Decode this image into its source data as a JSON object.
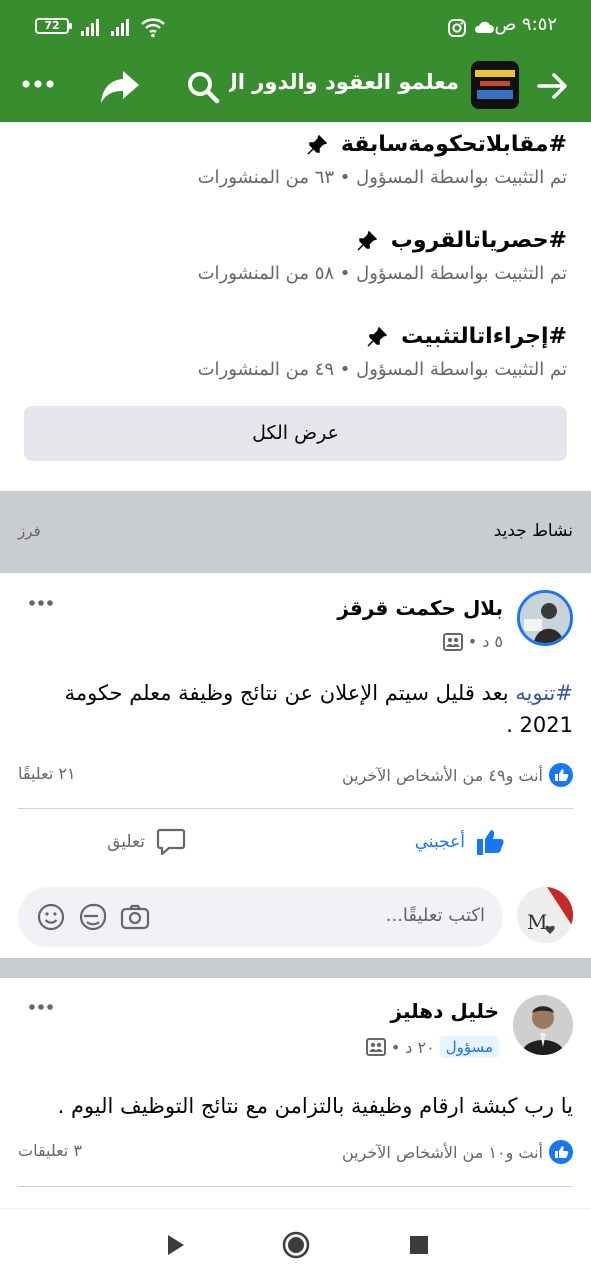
{
  "status_bar": {
    "time": "٩:٥٢ ص",
    "battery": "72"
  },
  "app_bar": {
    "title": "معلمو العقود والدور ال..",
    "back_icon": "arrow-right-icon",
    "search_icon": "search-icon",
    "share_icon": "share-icon",
    "more_icon": "more-icon"
  },
  "pinned": [
    {
      "tag": "#مقابلاتحكومةسابقة",
      "meta": "تم التثبيت بواسطة المسؤول • ٦٣ من المنشورات"
    },
    {
      "tag": "#حصرياتالقروب",
      "meta": "تم التثبيت بواسطة المسؤول • ٥٨ من المنشورات"
    },
    {
      "tag": "#إجراءاتالتثبيت",
      "meta": "تم التثبيت بواسطة المسؤول • ٤٩ من المنشورات"
    }
  ],
  "see_all_label": "عرض الكل",
  "activity": {
    "title": "نشاط جديد",
    "sort": "فرز"
  },
  "post1": {
    "author": "بلال حكمت قرقز",
    "time": "٥ د",
    "hashtag": "#تنويه",
    "text": " بعد قليل سيتم الإعلان عن نتائج وظيفة معلم حكومة 2021 .",
    "reactions": "أنت و٤٩ من الأشخاص الآخرين",
    "comments": "٢١ تعليقًا",
    "like_label": "أعجبني",
    "comment_label": "تعليق",
    "comment_placeholder": "اكتب تعليقًا..."
  },
  "post2": {
    "author": "خليل دهليز",
    "badge": "مسؤول",
    "time": "٢٠ د",
    "text": "يا رب كبشة ارقام وظيفية بالتزامن مع نتائج  التوظيف اليوم .",
    "reactions": "أنت و١٠ من الأشخاص الآخرين",
    "comments": "٣ تعليقات"
  },
  "colors": {
    "header_green": "#388e2e",
    "facebook_blue": "#1877f2",
    "hashtag_blue": "#385898",
    "muted_text": "#65676b"
  }
}
